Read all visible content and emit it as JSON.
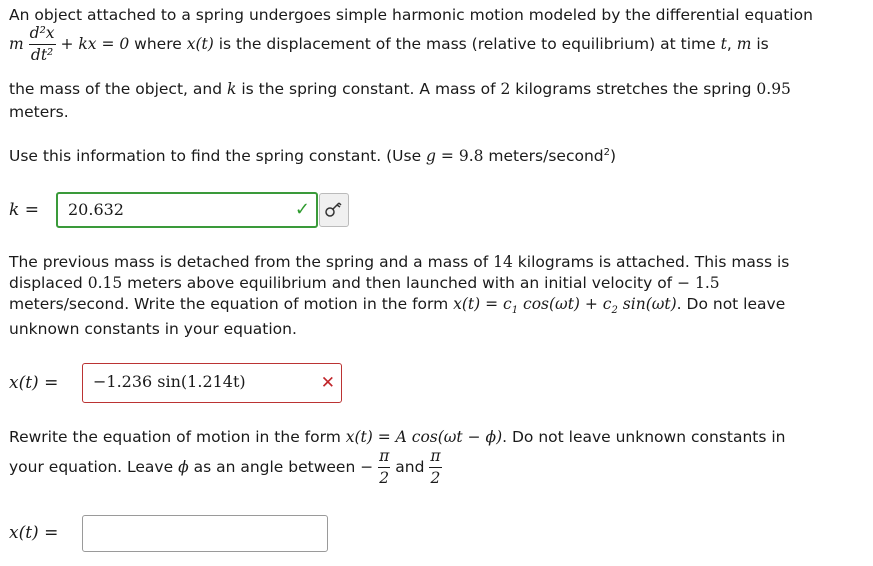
{
  "problem": {
    "intro_1": "An object attached to a spring undergoes simple harmonic motion modeled by the differential equation",
    "eq_m": "m",
    "eq_num": "d²x",
    "eq_den": "dt²",
    "eq_rest": "+ kx = 0",
    "intro_2a": " where ",
    "intro_2b": "x(t)",
    "intro_2c": " is the displacement of the mass (relative to equilibrium) at time ",
    "intro_2d": "t",
    "intro_2e": ", ",
    "intro_2f": "m",
    "intro_2g": " is",
    "intro_3a": "the mass of the object, and ",
    "intro_3b": "k",
    "intro_3c": " is the spring constant. A mass of ",
    "intro_3d": "2",
    "intro_3e": " kilograms stretches the spring ",
    "intro_3f": "0.95",
    "intro_4": "meters.",
    "use_a": "Use this information to find the spring constant. (Use ",
    "use_b": "g",
    "use_c": " = ",
    "use_d": "9.8",
    "use_e": " meters/second",
    "use_f": "2",
    "use_g": ")"
  },
  "part1": {
    "label": "k =",
    "value": "20.632",
    "status": "correct"
  },
  "part2": {
    "t1a": "The previous mass is detached from the spring and a mass of ",
    "t1b": "14",
    "t1c": " kilograms is attached. This mass is",
    "t2a": "displaced ",
    "t2b": "0.15",
    "t2c": " meters above equilibrium and then launched with an initial velocity of ",
    "t2d": "− 1.5",
    "t3a": "meters/second. Write the equation of motion in the form ",
    "t3b": "x(t) = c",
    "t3c": "1",
    "t3d": " cos(ωt) + c",
    "t3e": "2",
    "t3f": " sin(ωt)",
    "t3g": ". Do not leave",
    "t4": "unknown constants in your equation.",
    "label": "x(t) =",
    "value": "−1.236 sin(1.214t)",
    "status": "incorrect"
  },
  "part3": {
    "t1a": "Rewrite the equation of motion in the form ",
    "t1b": "x(t) = A cos(ωt − ϕ)",
    "t1c": ". Do not leave unknown constants in",
    "t2a": "your equation. Leave ",
    "t2b": "ϕ",
    "t2c": " as an angle between ",
    "neg": "−",
    "pi": "π",
    "two": "2",
    "and": " and ",
    "label": "x(t) =",
    "value": ""
  },
  "colors": {
    "correct": "#3a9a3a",
    "incorrect": "#c0252a"
  },
  "icons": {
    "check": "✓",
    "cross": "✕",
    "key": "key-icon"
  }
}
